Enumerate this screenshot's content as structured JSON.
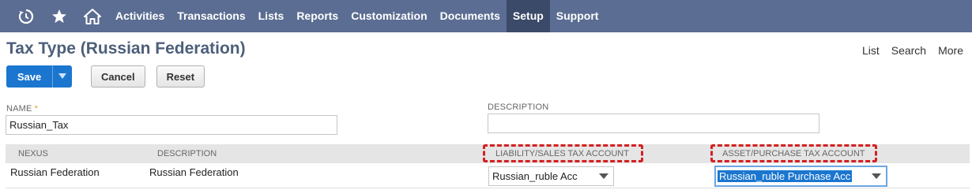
{
  "nav": {
    "icons": [
      "recent-icon",
      "star-icon",
      "home-icon"
    ],
    "items": [
      {
        "label": "Activities"
      },
      {
        "label": "Transactions"
      },
      {
        "label": "Lists"
      },
      {
        "label": "Reports"
      },
      {
        "label": "Customization"
      },
      {
        "label": "Documents"
      },
      {
        "label": "Setup",
        "active": true
      },
      {
        "label": "Support"
      }
    ]
  },
  "page": {
    "title": "Tax Type (Russian Federation)",
    "links": [
      "List",
      "Search",
      "More"
    ]
  },
  "toolbar": {
    "save_label": "Save",
    "cancel_label": "Cancel",
    "reset_label": "Reset"
  },
  "form": {
    "name_label": "NAME",
    "name_required": "*",
    "name_value": "Russian_Tax",
    "description_label": "DESCRIPTION",
    "description_value": ""
  },
  "table": {
    "headers": {
      "nexus": "NEXUS",
      "description": "DESCRIPTION",
      "liability": "LIABILITY/SALES TAX ACCOUNT",
      "asset": "ASSET/PURCHASE TAX ACCOUNT"
    },
    "rows": [
      {
        "nexus": "Russian Federation",
        "description": "Russian Federation",
        "liability": "Russian_ruble Acc",
        "asset": "Russian_ruble Purchase Acc"
      }
    ]
  },
  "colors": {
    "nav_bg": "#5b6d92",
    "nav_active": "#3b4a69",
    "title": "#4d5f79",
    "primary_button": "#1b76cf",
    "highlight": "#d42020"
  }
}
